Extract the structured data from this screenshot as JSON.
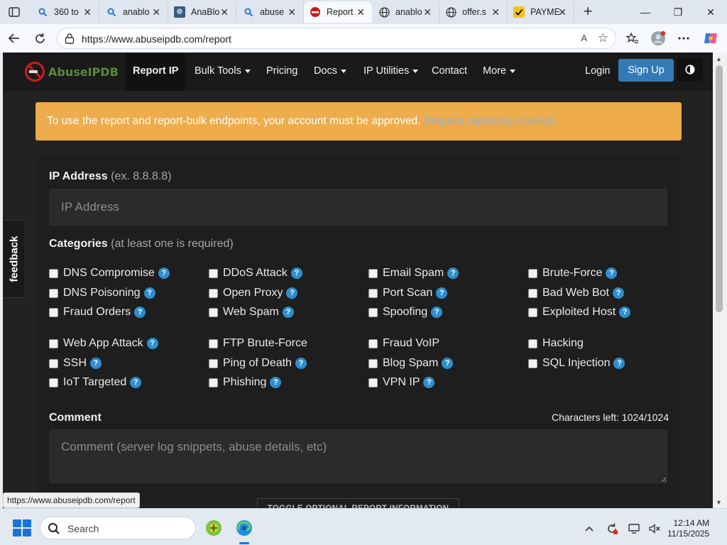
{
  "browser": {
    "tabs": [
      {
        "title": "360 to",
        "icon": "search-icon",
        "active": false
      },
      {
        "title": "anablo",
        "icon": "search-icon",
        "active": false
      },
      {
        "title": "AnaBlo",
        "icon": "image-icon",
        "active": false
      },
      {
        "title": "abuse",
        "icon": "search-icon",
        "active": false
      },
      {
        "title": "Report",
        "icon": "abuseipdb-icon",
        "active": true
      },
      {
        "title": "anablo",
        "icon": "globe-icon",
        "active": false
      },
      {
        "title": "offer.s",
        "icon": "globe-icon",
        "active": false
      },
      {
        "title": "PAYME",
        "icon": "check-icon",
        "active": false
      }
    ],
    "url": "https://www.abuseipdb.com/report",
    "read_aloud": "A",
    "status_url": "https://www.abuseipdb.com/report"
  },
  "site": {
    "logo_text": "AbuseIPDB",
    "nav": {
      "report_ip": "Report IP",
      "bulk_tools": "Bulk Tools",
      "pricing": "Pricing",
      "docs": "Docs",
      "ip_utilities": "IP Utilities",
      "contact": "Contact",
      "more": "More",
      "login": "Login",
      "signup": "Sign Up"
    },
    "alert": {
      "text": "To use the report and report-bulk endpoints, your account must be approved.",
      "link": "Request reporting privilege."
    },
    "form": {
      "ip_label": "IP Address",
      "ip_hint": "(ex. 8.8.8.8)",
      "ip_placeholder": "IP Address",
      "categories_label": "Categories",
      "categories_hint": "(at least one is required)",
      "categories": [
        {
          "label": "DNS Compromise",
          "help": true
        },
        {
          "label": "DDoS Attack",
          "help": true
        },
        {
          "label": "Email Spam",
          "help": true
        },
        {
          "label": "Brute-Force",
          "help": true
        },
        {
          "label": "DNS Poisoning",
          "help": true
        },
        {
          "label": "Open Proxy",
          "help": true
        },
        {
          "label": "Port Scan",
          "help": true
        },
        {
          "label": "Bad Web Bot",
          "help": true
        },
        {
          "label": "Fraud Orders",
          "help": true
        },
        {
          "label": "Web Spam",
          "help": true
        },
        {
          "label": "Spoofing",
          "help": true
        },
        {
          "label": "Exploited Host",
          "help": true
        },
        {
          "label": "Web App Attack",
          "help": true
        },
        {
          "label": "FTP Brute-Force",
          "help": false
        },
        {
          "label": "Fraud VoIP",
          "help": false
        },
        {
          "label": "Hacking",
          "help": false
        },
        {
          "label": "SSH",
          "help": true
        },
        {
          "label": "Ping of Death",
          "help": true
        },
        {
          "label": "Blog Spam",
          "help": true
        },
        {
          "label": "SQL Injection",
          "help": true
        },
        {
          "label": "IoT Targeted",
          "help": true
        },
        {
          "label": "Phishing",
          "help": true
        },
        {
          "label": "VPN IP",
          "help": true
        }
      ],
      "help_glyph": "?",
      "comment_label": "Comment",
      "chars_left": "Characters left: 1024/1024",
      "comment_placeholder": "Comment (server log snippets, abuse details, etc)",
      "toggle_optional": "TOGGLE OPTIONAL REPORT INFORMATION"
    },
    "feedback": "feedback"
  },
  "taskbar": {
    "search_label": "Search",
    "time": "12:14 AM",
    "date": "11/15/2025"
  },
  "colors": {
    "accent": "#337ab7",
    "alert": "#eeac4b",
    "help_icon": "#2d8fd0",
    "page_bg": "#222222"
  }
}
